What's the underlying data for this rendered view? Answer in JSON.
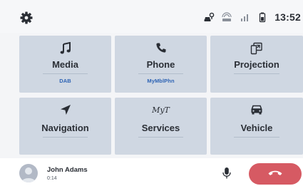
{
  "status": {
    "icons": [
      "car-key-icon",
      "hotspot-icon",
      "signal-icon",
      "battery-icon"
    ],
    "time": "13:52"
  },
  "tiles": [
    {
      "icon": "music-note-icon",
      "label": "Media",
      "sub": "DAB"
    },
    {
      "icon": "phone-icon",
      "label": "Phone",
      "sub": "MyMblPhn"
    },
    {
      "icon": "projection-icon",
      "label": "Projection",
      "sub": ""
    },
    {
      "icon": "navigation-arrow-icon",
      "label": "Navigation",
      "sub": ""
    },
    {
      "icon": "services-logo-icon",
      "label": "Services",
      "sub": ""
    },
    {
      "icon": "car-icon",
      "label": "Vehicle",
      "sub": ""
    }
  ],
  "services_logo_text": "MyT",
  "call": {
    "name": "John Adams",
    "duration": "0:14"
  },
  "colors": {
    "tile_bg": "#cfd7e2",
    "accent_blue": "#2d63b4",
    "hangup_red": "#d65a63"
  }
}
